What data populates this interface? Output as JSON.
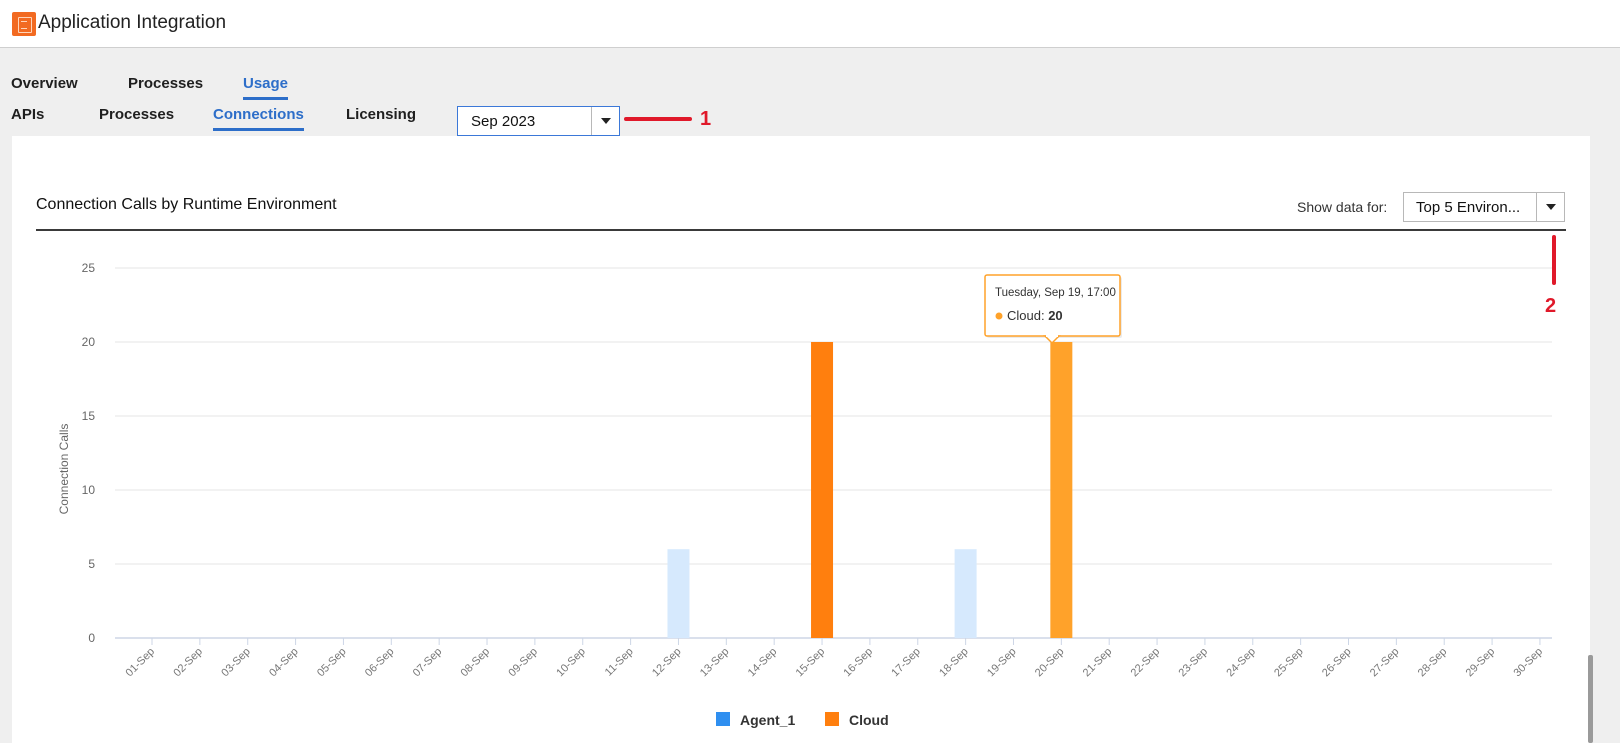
{
  "app": {
    "title": "Application Integration",
    "logo_icon": "app-integration-logo-icon"
  },
  "main_tabs": [
    {
      "label": "Overview",
      "active": false
    },
    {
      "label": "Processes",
      "active": false
    },
    {
      "label": "Usage",
      "active": true
    }
  ],
  "sub_tabs": [
    {
      "label": "APIs",
      "active": false
    },
    {
      "label": "Processes",
      "active": false
    },
    {
      "label": "Connections",
      "active": true
    },
    {
      "label": "Licensing",
      "active": false
    }
  ],
  "month_select": {
    "value": "Sep 2023"
  },
  "annotations": {
    "marker_1": "1",
    "marker_2": "2",
    "color": "#e0192a"
  },
  "filter": {
    "label": "Show data for:",
    "value": "Top 5 Environ..."
  },
  "tooltip": {
    "date": "Tuesday, Sep 19, 17:00",
    "series": "Cloud",
    "separator": ":",
    "value": "20"
  },
  "colors": {
    "accent": "#2d6ec9",
    "agent": "#2f8ff0",
    "agent_faded": "#d6e9fd",
    "cloud": "#ff7f0e",
    "cloud_hover": "#ffa22a"
  },
  "chart_data": {
    "type": "bar",
    "title": "Connection Calls by Runtime Environment",
    "ylabel": "Connection Calls",
    "xlabel": "",
    "ylim": [
      0,
      25
    ],
    "yticks": [
      0,
      5,
      10,
      15,
      20,
      25
    ],
    "categories": [
      "01-Sep",
      "02-Sep",
      "03-Sep",
      "04-Sep",
      "05-Sep",
      "06-Sep",
      "07-Sep",
      "08-Sep",
      "09-Sep",
      "10-Sep",
      "11-Sep",
      "12-Sep",
      "13-Sep",
      "14-Sep",
      "15-Sep",
      "16-Sep",
      "17-Sep",
      "18-Sep",
      "19-Sep",
      "20-Sep",
      "21-Sep",
      "22-Sep",
      "23-Sep",
      "24-Sep",
      "25-Sep",
      "26-Sep",
      "27-Sep",
      "28-Sep",
      "29-Sep",
      "30-Sep"
    ],
    "series": [
      {
        "name": "Agent_1",
        "color": "#2f8ff0",
        "values": [
          0,
          0,
          0,
          0,
          0,
          0,
          0,
          0,
          0,
          0,
          0,
          6,
          0,
          0,
          0,
          0,
          0,
          6,
          0,
          0,
          0,
          0,
          0,
          0,
          0,
          0,
          0,
          0,
          0,
          0
        ]
      },
      {
        "name": "Cloud",
        "color": "#ff7f0e",
        "values": [
          0,
          0,
          0,
          0,
          0,
          0,
          0,
          0,
          0,
          0,
          0,
          0,
          0,
          0,
          20,
          0,
          0,
          0,
          0,
          20,
          0,
          0,
          0,
          0,
          0,
          0,
          0,
          0,
          0,
          0
        ]
      }
    ],
    "legend_position": "bottom-center",
    "grid": true
  }
}
